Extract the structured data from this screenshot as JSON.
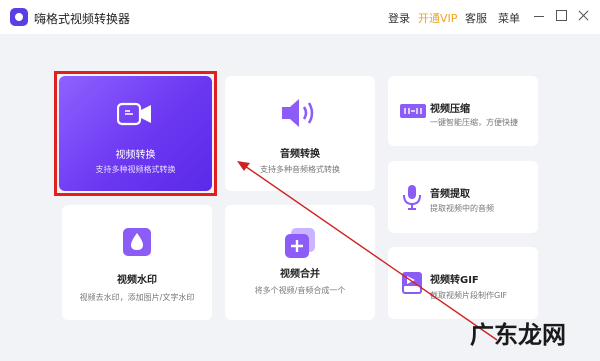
{
  "app": {
    "title": "嗨格式视频转换器"
  },
  "top_menu": {
    "login": "登录",
    "vip": "开通VIP",
    "service": "客服",
    "menu": "菜单"
  },
  "cards": {
    "video_convert": {
      "title": "视频转换",
      "desc": "支持多种视频格式转换"
    },
    "audio_convert": {
      "title": "音频转换",
      "desc": "支持多种音频格式转换"
    },
    "video_compress": {
      "title": "视频压缩",
      "desc": "一键智能压缩，方便快捷"
    },
    "audio_extract": {
      "title": "音频提取",
      "desc": "提取视频中的音频"
    },
    "video_watermark": {
      "title": "视频水印",
      "desc": "视频去水印，添加图片/文字水印"
    },
    "video_merge": {
      "title": "视频合并",
      "desc": "将多个视频/音频合成一个"
    },
    "video_to_gif": {
      "title": "视频转GIF",
      "desc": "截取视频片段制作GIF"
    }
  },
  "watermark": "广东龙网",
  "colors": {
    "accent": "#6c38f2",
    "highlight": "#e01f1f",
    "vip": "#f0a21f"
  }
}
